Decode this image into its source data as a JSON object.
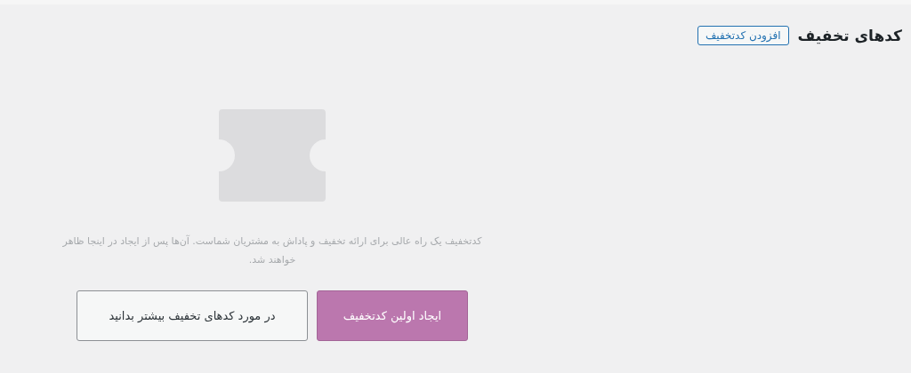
{
  "header": {
    "title": "کدهای تخفیف",
    "add_button": "افزودن کدتخفیف"
  },
  "empty_state": {
    "message": "کدتخفیف یک راه عالی برای ارائه تخفیف و پاداش به مشتریان شماست. آن‌ها پس از ایجاد در اینجا ظاهر خواهند شد.",
    "buttons": [
      {
        "label": "ایجاد اولین کدتخفیف",
        "kind": "primary"
      },
      {
        "label": "در مورد کدهای تخفیف بیشتر بدانید",
        "kind": "secondary"
      }
    ]
  }
}
